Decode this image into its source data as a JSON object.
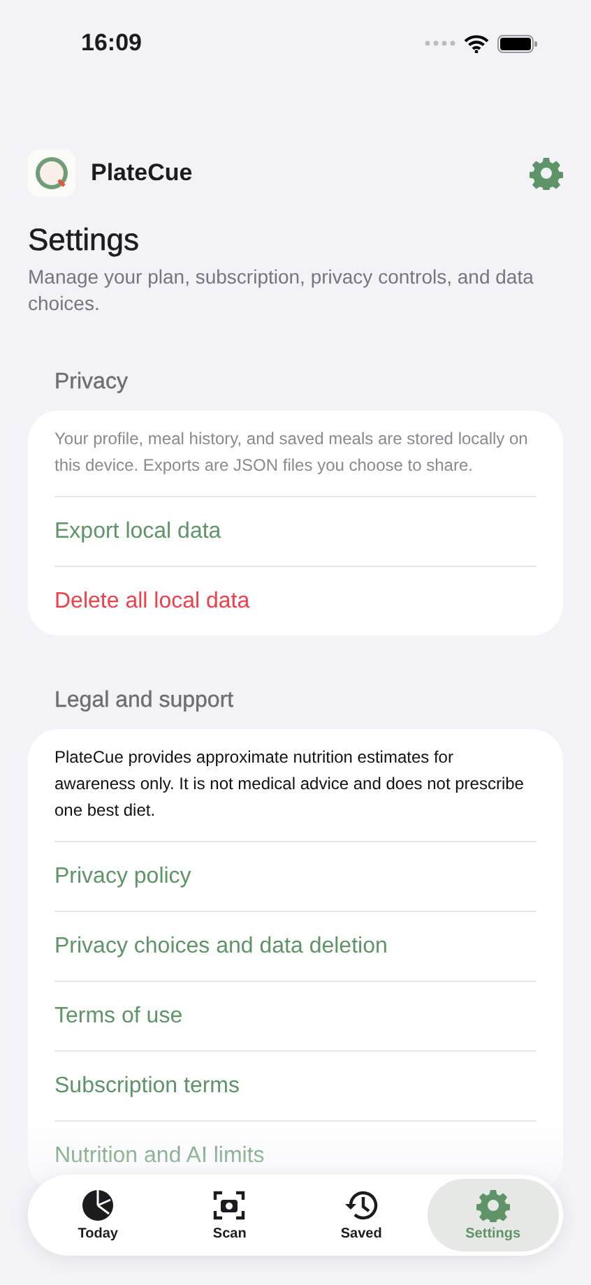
{
  "status_bar": {
    "time": "16:09"
  },
  "app": {
    "name": "PlateCue"
  },
  "header": {
    "title": "Settings",
    "subtitle": "Manage your plan, subscription, privacy controls, and data choices."
  },
  "sections": [
    {
      "title": "Privacy",
      "note": "Your profile, meal history, and saved meals are stored locally on this device. Exports are JSON files you choose to share.",
      "note_muted": true,
      "rows": [
        {
          "label": "Export local data",
          "kind": "link"
        },
        {
          "label": "Delete all local data",
          "kind": "destructive"
        }
      ]
    },
    {
      "title": "Legal and support",
      "note": "PlateCue provides approximate nutrition estimates for awareness only. It is not medical advice and does not prescribe one best diet.",
      "note_muted": false,
      "rows": [
        {
          "label": "Privacy policy",
          "kind": "link"
        },
        {
          "label": "Privacy choices and data deletion",
          "kind": "link"
        },
        {
          "label": "Terms of use",
          "kind": "link"
        },
        {
          "label": "Subscription terms",
          "kind": "link"
        },
        {
          "label": "Nutrition and AI limits",
          "kind": "link"
        }
      ]
    }
  ],
  "tabs": [
    {
      "label": "Today",
      "selected": false
    },
    {
      "label": "Scan",
      "selected": false
    },
    {
      "label": "Saved",
      "selected": false
    },
    {
      "label": "Settings",
      "selected": true
    }
  ]
}
